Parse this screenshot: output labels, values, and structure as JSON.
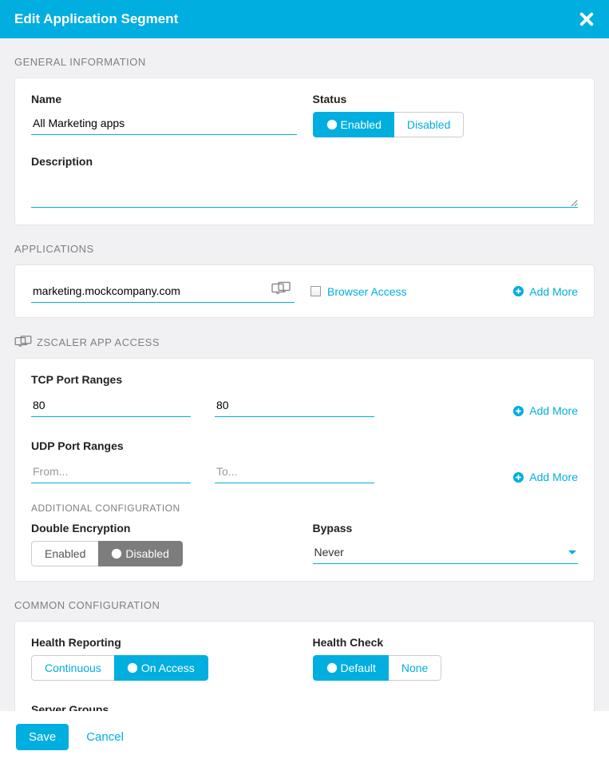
{
  "header": {
    "title": "Edit Application Segment"
  },
  "general": {
    "section_label": "GENERAL INFORMATION",
    "name_label": "Name",
    "name_value": "All Marketing apps",
    "status_label": "Status",
    "enabled_label": "Enabled",
    "disabled_label": "Disabled",
    "description_label": "Description",
    "description_value": ""
  },
  "applications": {
    "section_label": "APPLICATIONS",
    "app_value": "marketing.mockcompany.com",
    "browser_access_label": "Browser Access",
    "add_more": "Add More"
  },
  "zscaler": {
    "section_label": "ZSCALER APP ACCESS",
    "tcp_label": "TCP Port Ranges",
    "tcp_from": "80",
    "tcp_to": "80",
    "udp_label": "UDP Port Ranges",
    "udp_from": "",
    "udp_to": "",
    "from_placeholder": "From...",
    "to_placeholder": "To...",
    "add_more": "Add More",
    "additional_label": "ADDITIONAL CONFIGURATION",
    "double_enc_label": "Double Encryption",
    "enabled_label": "Enabled",
    "disabled_label": "Disabled",
    "bypass_label": "Bypass",
    "bypass_value": "Never"
  },
  "common": {
    "section_label": "COMMON CONFIGURATION",
    "health_reporting_label": "Health Reporting",
    "continuous_label": "Continuous",
    "on_access_label": "On Access",
    "health_check_label": "Health Check",
    "default_label": "Default",
    "none_label": "None",
    "server_groups_label": "Server Groups"
  },
  "footer": {
    "save": "Save",
    "cancel": "Cancel"
  }
}
